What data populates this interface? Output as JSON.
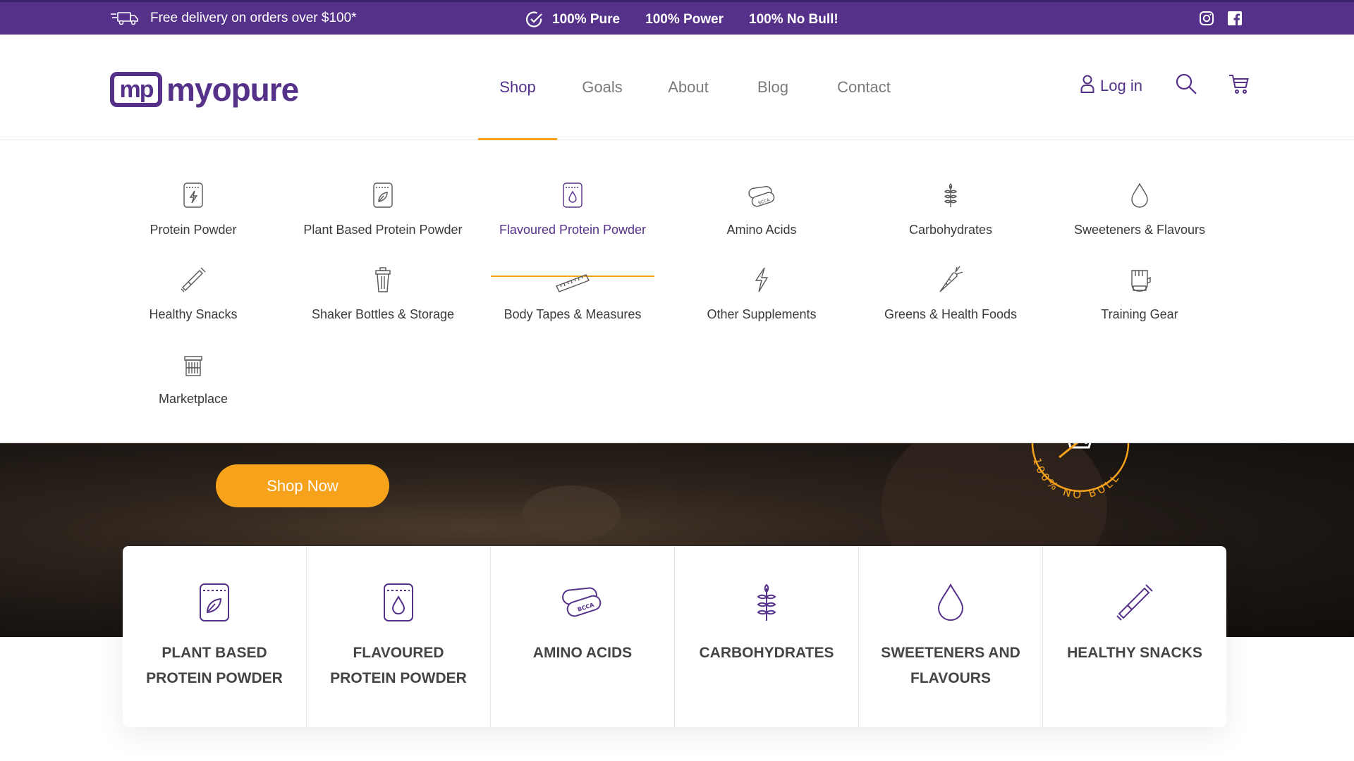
{
  "topbar": {
    "delivery_text": "Free delivery on orders over $100*",
    "promise_1": "100% Pure",
    "promise_2": "100% Power",
    "promise_3": "100% No Bull!",
    "social": [
      "instagram-icon",
      "facebook-icon"
    ]
  },
  "header": {
    "logo_mark": "mp",
    "logo_text": "myopure",
    "nav": [
      {
        "label": "Shop",
        "active": true
      },
      {
        "label": "Goals",
        "active": false
      },
      {
        "label": "About",
        "active": false
      },
      {
        "label": "Blog",
        "active": false
      },
      {
        "label": "Contact",
        "active": false
      }
    ],
    "login_label": "Log in"
  },
  "mega_menu": {
    "items": [
      {
        "label": "Protein Powder",
        "icon": "protein-pouch-icon"
      },
      {
        "label": "Plant Based Protein Powder",
        "icon": "leaf-pouch-icon"
      },
      {
        "label": "Flavoured Protein Powder",
        "icon": "drop-pouch-icon",
        "active": true
      },
      {
        "label": "Amino Acids",
        "icon": "bcaa-capsule-icon"
      },
      {
        "label": "Carbohydrates",
        "icon": "wheat-icon"
      },
      {
        "label": "Sweeteners & Flavours",
        "icon": "drop-icon"
      },
      {
        "label": "Healthy Snacks",
        "icon": "snack-bar-icon"
      },
      {
        "label": "Shaker Bottles & Storage",
        "icon": "shaker-icon"
      },
      {
        "label": "Body Tapes & Measures",
        "icon": "tape-measure-icon"
      },
      {
        "label": "Other Supplements",
        "icon": "lightning-icon"
      },
      {
        "label": "Greens & Health Foods",
        "icon": "carrot-icon"
      },
      {
        "label": "Training Gear",
        "icon": "glove-icon"
      },
      {
        "label": "Marketplace",
        "icon": "store-icon"
      }
    ]
  },
  "hero": {
    "cta_label": "Shop Now",
    "badge_text": "100% NO BULL"
  },
  "categories": [
    {
      "label": "Plant Based Protein Powder",
      "icon": "leaf-pouch-icon"
    },
    {
      "label": "Flavoured Protein Powder",
      "icon": "drop-pouch-icon"
    },
    {
      "label": "Amino Acids",
      "icon": "bcaa-capsule-icon"
    },
    {
      "label": "Carbohydrates",
      "icon": "wheat-icon"
    },
    {
      "label": "Sweeteners and Flavours",
      "icon": "drop-icon"
    },
    {
      "label": "Healthy Snacks",
      "icon": "snack-bar-icon"
    }
  ],
  "colors": {
    "brand_purple": "#55318a",
    "accent_orange": "#f7a21b"
  }
}
